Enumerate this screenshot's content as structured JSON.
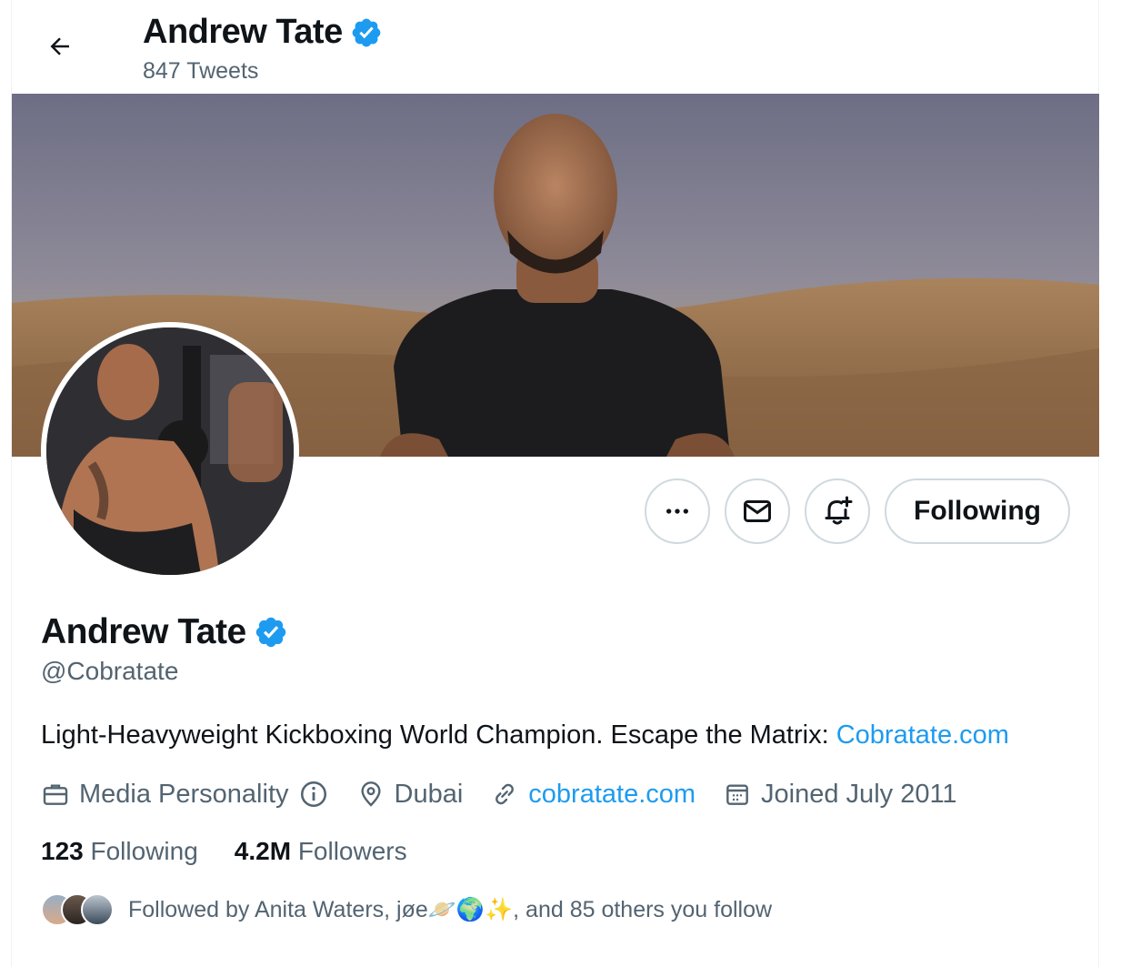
{
  "header": {
    "name": "Andrew Tate",
    "tweet_count": "847 Tweets"
  },
  "actions": {
    "following_label": "Following"
  },
  "profile": {
    "name": "Andrew Tate",
    "handle": "@Cobratate",
    "bio_text": "Light-Heavyweight Kickboxing World Champion. Escape the Matrix:",
    "bio_link": "Cobratate.com",
    "category": "Media Personality",
    "location": "Dubai",
    "website": "cobratate.com",
    "joined": "Joined July 2011"
  },
  "stats": {
    "following_count": "123",
    "following_label": "Following",
    "followers_count": "4.2M",
    "followers_label": "Followers"
  },
  "followed_by": {
    "text": "Followed by Anita Waters, jøe🪐🌍✨, and 85 others you follow"
  },
  "colors": {
    "accent": "#1d9bf0",
    "secondary_text": "#536471",
    "border": "#cfd9de"
  }
}
